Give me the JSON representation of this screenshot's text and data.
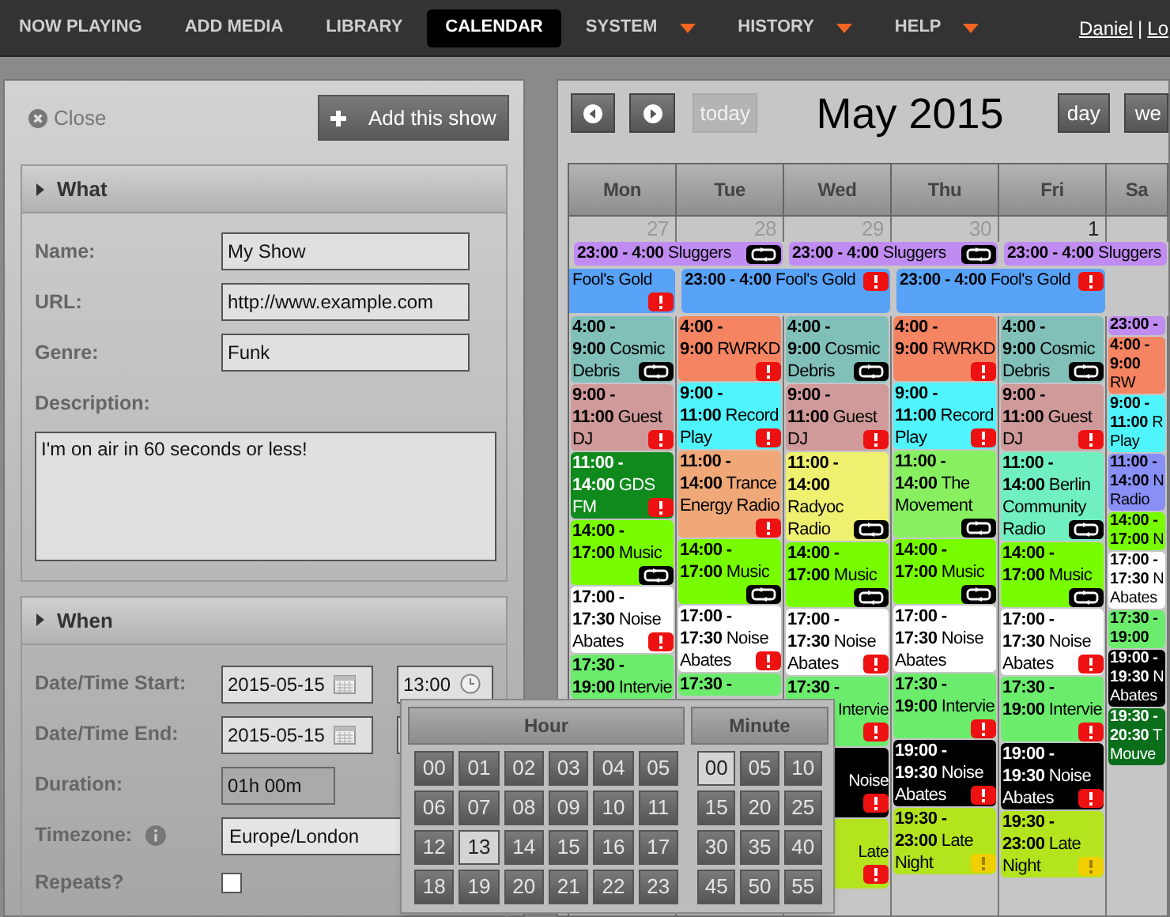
{
  "nav": {
    "items": [
      {
        "label": "NOW PLAYING",
        "selected": false,
        "has_menu": false
      },
      {
        "label": "ADD MEDIA",
        "selected": false,
        "has_menu": false
      },
      {
        "label": "LIBRARY",
        "selected": false,
        "has_menu": false
      },
      {
        "label": "CALENDAR",
        "selected": true,
        "has_menu": false
      },
      {
        "label": "SYSTEM",
        "selected": false,
        "has_menu": true
      },
      {
        "label": "HISTORY",
        "selected": false,
        "has_menu": true
      },
      {
        "label": "HELP",
        "selected": false,
        "has_menu": true
      }
    ],
    "user": "Daniel",
    "separator": "|",
    "logout": "Lo"
  },
  "show_form": {
    "close": "Close",
    "add_button": "Add this show",
    "what": {
      "title": "What",
      "fields": [
        {
          "label": "Name:",
          "value": "My Show"
        },
        {
          "label": "URL:",
          "value": "http://www.example.com"
        },
        {
          "label": "Genre:",
          "value": "Funk"
        }
      ],
      "description_label": "Description:",
      "description": "I'm on air in 60 seconds or less!"
    },
    "when": {
      "title": "When",
      "start_label": "Date/Time Start:",
      "start_date": "2015-05-15",
      "start_time": "13:00",
      "end_label": "Date/Time End:",
      "end_date": "2015-05-15",
      "duration_label": "Duration:",
      "duration": "01h 00m",
      "timezone_label": "Timezone:",
      "timezone": "Europe/London",
      "repeats_label": "Repeats?",
      "repeats": false
    }
  },
  "time_picker": {
    "hour_title": "Hour",
    "minute_title": "Minute",
    "hours": [
      {
        "label": "00",
        "selected": false
      },
      {
        "label": "01",
        "selected": false
      },
      {
        "label": "02",
        "selected": false
      },
      {
        "label": "03",
        "selected": false
      },
      {
        "label": "04",
        "selected": false
      },
      {
        "label": "05",
        "selected": false
      },
      {
        "label": "06",
        "selected": false
      },
      {
        "label": "07",
        "selected": false
      },
      {
        "label": "08",
        "selected": false
      },
      {
        "label": "09",
        "selected": false
      },
      {
        "label": "10",
        "selected": false
      },
      {
        "label": "11",
        "selected": false
      },
      {
        "label": "12",
        "selected": false
      },
      {
        "label": "13",
        "selected": true
      },
      {
        "label": "14",
        "selected": false
      },
      {
        "label": "15",
        "selected": false
      },
      {
        "label": "16",
        "selected": false
      },
      {
        "label": "17",
        "selected": false
      },
      {
        "label": "18",
        "selected": false
      },
      {
        "label": "19",
        "selected": false
      },
      {
        "label": "20",
        "selected": false
      },
      {
        "label": "21",
        "selected": false
      },
      {
        "label": "22",
        "selected": false
      },
      {
        "label": "23",
        "selected": false
      }
    ],
    "minutes": [
      {
        "label": "00",
        "selected": true
      },
      {
        "label": "05",
        "selected": false
      },
      {
        "label": "10",
        "selected": false
      },
      {
        "label": "15",
        "selected": false
      },
      {
        "label": "20",
        "selected": false
      },
      {
        "label": "25",
        "selected": false
      },
      {
        "label": "30",
        "selected": false
      },
      {
        "label": "35",
        "selected": false
      },
      {
        "label": "40",
        "selected": false
      },
      {
        "label": "45",
        "selected": false
      },
      {
        "label": "50",
        "selected": false
      },
      {
        "label": "55",
        "selected": false
      }
    ]
  },
  "calendar": {
    "title": "May 2015",
    "today": "today",
    "today_disabled": true,
    "views": [
      {
        "label": "day",
        "selected": false
      },
      {
        "label": "we",
        "selected": false
      }
    ],
    "days": [
      {
        "name": "Mon",
        "number": "27",
        "in_month": false
      },
      {
        "name": "Tue",
        "number": "28",
        "in_month": false
      },
      {
        "name": "Wed",
        "number": "29",
        "in_month": false
      },
      {
        "name": "Thu",
        "number": "30",
        "in_month": false
      },
      {
        "name": "Fri",
        "number": "1",
        "in_month": true
      },
      {
        "name": "Sa"
      }
    ],
    "banner_rows": [
      {
        "bars": [
          {
            "time": "23:00 - 4:00",
            "title": "Sluggers",
            "color": "#c08cf2",
            "recurring": true,
            "conflict": false,
            "warning": false,
            "continued_from_before": false,
            "continues_next": true
          },
          {
            "time": "23:00 - 4:00",
            "title": "Sluggers",
            "color": "#c08cf2",
            "recurring": true,
            "conflict": false,
            "warning": false,
            "continued_from_before": false,
            "continues_next": true
          },
          {
            "time": "23:00 - 4:00",
            "title": "Sluggers",
            "color": "#c08cf2",
            "recurring": false,
            "conflict": false,
            "warning": false,
            "continued_from_before": false,
            "continues_next": true
          }
        ]
      },
      {
        "bars": [
          {
            "title": "Fool's Gold",
            "color": "#58a2f8",
            "recurring": false,
            "conflict": true,
            "warning": false,
            "continued_from_before": true,
            "continues_next": false
          },
          {
            "time": "23:00 - 4:00",
            "title": "Fool's Gold",
            "color": "#58a2f8",
            "recurring": false,
            "conflict": true,
            "warning": false,
            "continued_from_before": false,
            "continues_next": true
          },
          {
            "time": "23:00 - 4:00",
            "title": "Fool's Gold",
            "color": "#58a2f8",
            "recurring": false,
            "conflict": true,
            "warning": false,
            "continued_from_before": false,
            "continues_next": true
          }
        ]
      }
    ],
    "columns": [
      {
        "events": [
          {
            "start": "4:00 -",
            "end": "9:00",
            "title": "Cosmic Debris",
            "color": "#80c0b8",
            "recurring": true,
            "conflict": false,
            "warning": false
          },
          {
            "start": "9:00 -",
            "end": "11:00",
            "title": "Guest DJ",
            "color": "#d09a9a",
            "recurring": false,
            "conflict": true,
            "warning": false
          },
          {
            "start": "11:00 -",
            "end": "14:00",
            "title": "GDS FM",
            "color": "#108a1c",
            "recurring": false,
            "conflict": true,
            "warning": false
          },
          {
            "start": "14:00 -",
            "end": "17:00",
            "title": "Music",
            "color": "#78fc00",
            "recurring": true,
            "conflict": false,
            "warning": false
          },
          {
            "start": "17:00 -",
            "end": "17:30",
            "title": "Noise Abates",
            "color": "#ffffff",
            "recurring": false,
            "conflict": true,
            "warning": false
          },
          {
            "start": "17:30 -",
            "end": "19:00",
            "title": "Intervie",
            "color": "#6cec6c",
            "recurring": false,
            "conflict": false,
            "warning": false
          }
        ]
      },
      {
        "events": [
          {
            "start": "4:00 -",
            "end": "9:00",
            "title": "RWRKD",
            "color": "#f48462",
            "recurring": false,
            "conflict": true,
            "warning": false
          },
          {
            "start": "9:00 -",
            "end": "11:00",
            "title": "Record Play",
            "color": "#50f4fc",
            "recurring": false,
            "conflict": true,
            "warning": false
          },
          {
            "start": "11:00 -",
            "end": "14:00",
            "title": "Trance Energy Radio",
            "color": "#f0a878",
            "recurring": false,
            "conflict": true,
            "warning": false
          },
          {
            "start": "14:00 -",
            "end": "17:00",
            "title": "Music",
            "color": "#78fc00",
            "recurring": true,
            "conflict": false,
            "warning": false
          },
          {
            "start": "17:00 -",
            "end": "17:30",
            "title": "Noise Abates",
            "color": "#ffffff",
            "recurring": false,
            "conflict": true,
            "warning": false
          },
          {
            "start": "17:30 -",
            "color": "#6cec6c",
            "recurring": false,
            "conflict": false,
            "warning": false
          }
        ]
      },
      {
        "events": [
          {
            "start": "4:00 -",
            "end": "9:00",
            "title": "Cosmic Debris",
            "color": "#80c0b8",
            "recurring": true,
            "conflict": false,
            "warning": false,
            "covered": false
          },
          {
            "start": "9:00 -",
            "end": "11:00",
            "title": "Guest DJ",
            "color": "#d09a9a",
            "recurring": false,
            "conflict": true,
            "warning": false,
            "covered": false
          },
          {
            "start": "11:00 -",
            "end": "14:00",
            "title": "Radyoc Radio",
            "color": "#f0f070",
            "recurring": true,
            "conflict": false,
            "warning": false,
            "covered": false
          },
          {
            "start": "14:00 -",
            "end": "17:00",
            "title": "Music",
            "color": "#78fc00",
            "recurring": true,
            "conflict": false,
            "warning": false,
            "covered": false
          },
          {
            "start": "17:00 -",
            "end": "17:30",
            "title": "Noise Abates",
            "color": "#ffffff",
            "recurring": false,
            "conflict": true,
            "warning": false,
            "covered": false
          },
          {
            "start": "17:30 -",
            "title": "Intervie",
            "color": "#6cec6c",
            "recurring": false,
            "conflict": true,
            "warning": false,
            "covered": true
          },
          {
            "title": "Noise",
            "color": "#000000",
            "recurring": false,
            "conflict": true,
            "warning": false,
            "covered": true
          },
          {
            "title": "Late",
            "color": "#b4e41e",
            "recurring": false,
            "conflict": true,
            "warning": false,
            "covered": true
          }
        ]
      },
      {
        "events": [
          {
            "start": "4:00 -",
            "end": "9:00",
            "title": "RWRKD",
            "color": "#f48462",
            "recurring": false,
            "conflict": true,
            "warning": false
          },
          {
            "start": "9:00 -",
            "end": "11:00",
            "title": "Record Play",
            "color": "#50f4fc",
            "recurring": false,
            "conflict": true,
            "warning": false
          },
          {
            "start": "11:00 -",
            "end": "14:00",
            "title": "The Movement",
            "color": "#88f060",
            "recurring": true,
            "conflict": false,
            "warning": false
          },
          {
            "start": "14:00 -",
            "end": "17:00",
            "title": "Music",
            "color": "#78fc00",
            "recurring": true,
            "conflict": false,
            "warning": false
          },
          {
            "start": "17:00 -",
            "end": "17:30",
            "title": "Noise Abates",
            "color": "#ffffff",
            "recurring": false,
            "conflict": false,
            "warning": false
          },
          {
            "start": "17:30 -",
            "end": "19:00",
            "title": "Intervie",
            "color": "#6cec6c",
            "recurring": false,
            "conflict": true,
            "warning": false
          },
          {
            "start": "19:00 -",
            "end": "19:30",
            "title": "Noise Abates",
            "color": "#000000",
            "recurring": false,
            "conflict": true,
            "warning": false
          },
          {
            "start": "19:30 -",
            "end": "23:00",
            "title": "Late Night",
            "color": "#b4e41e",
            "recurring": false,
            "conflict": false,
            "warning": true
          }
        ]
      },
      {
        "events": [
          {
            "start": "4:00 -",
            "end": "9:00",
            "title": "Cosmic Debris",
            "color": "#80c0b8",
            "recurring": true,
            "conflict": false,
            "warning": false
          },
          {
            "start": "9:00 -",
            "end": "11:00",
            "title": "Guest DJ",
            "color": "#d09a9a",
            "recurring": false,
            "conflict": true,
            "warning": false
          },
          {
            "start": "11:00 -",
            "end": "14:00",
            "title": "Berlin Community Radio",
            "color": "#70f0c0",
            "recurring": true,
            "conflict": false,
            "warning": false
          },
          {
            "start": "14:00 -",
            "end": "17:00",
            "title": "Music",
            "color": "#78fc00",
            "recurring": true,
            "conflict": false,
            "warning": false
          },
          {
            "start": "17:00 -",
            "end": "17:30",
            "title": "Noise Abates",
            "color": "#ffffff",
            "recurring": false,
            "conflict": true,
            "warning": false
          },
          {
            "start": "17:30 -",
            "end": "19:00",
            "title": "Intervie",
            "color": "#6cec6c",
            "recurring": false,
            "conflict": true,
            "warning": false
          },
          {
            "start": "19:00 -",
            "end": "19:30",
            "title": "Noise Abates",
            "color": "#000000",
            "recurring": false,
            "conflict": true,
            "warning": false
          },
          {
            "start": "19:30 -",
            "end": "23:00",
            "title": "Late Night",
            "color": "#b4e41e",
            "recurring": false,
            "conflict": false,
            "warning": true
          }
        ]
      },
      {
        "events": [
          {
            "start": "23:00 -",
            "color": "#c08cf2"
          },
          {
            "start": "4:00 -",
            "end": "9:00",
            "title": "RW",
            "color": "#f48462"
          },
          {
            "start": "9:00 -",
            "end": "11:00",
            "title": "R Play",
            "color": "#50f4fc"
          },
          {
            "start": "11:00 -",
            "end": "14:00",
            "title": "N Radio",
            "color": "#8890f8"
          },
          {
            "start": "14:00 -",
            "end": "17:00",
            "title": "N",
            "color": "#78fc00"
          },
          {
            "start": "17:00 -",
            "end": "17:30",
            "title": "N Abates",
            "color": "#ffffff"
          },
          {
            "start": "17:30 -",
            "end": "19:00",
            "color": "#6cec6c"
          },
          {
            "start": "19:00 -",
            "end": "19:30",
            "title": "N Abates",
            "color": "#000000"
          },
          {
            "start": "19:30 -",
            "end": "20:30",
            "title": "T Mouve",
            "color": "#0a6e1a"
          }
        ]
      }
    ]
  }
}
